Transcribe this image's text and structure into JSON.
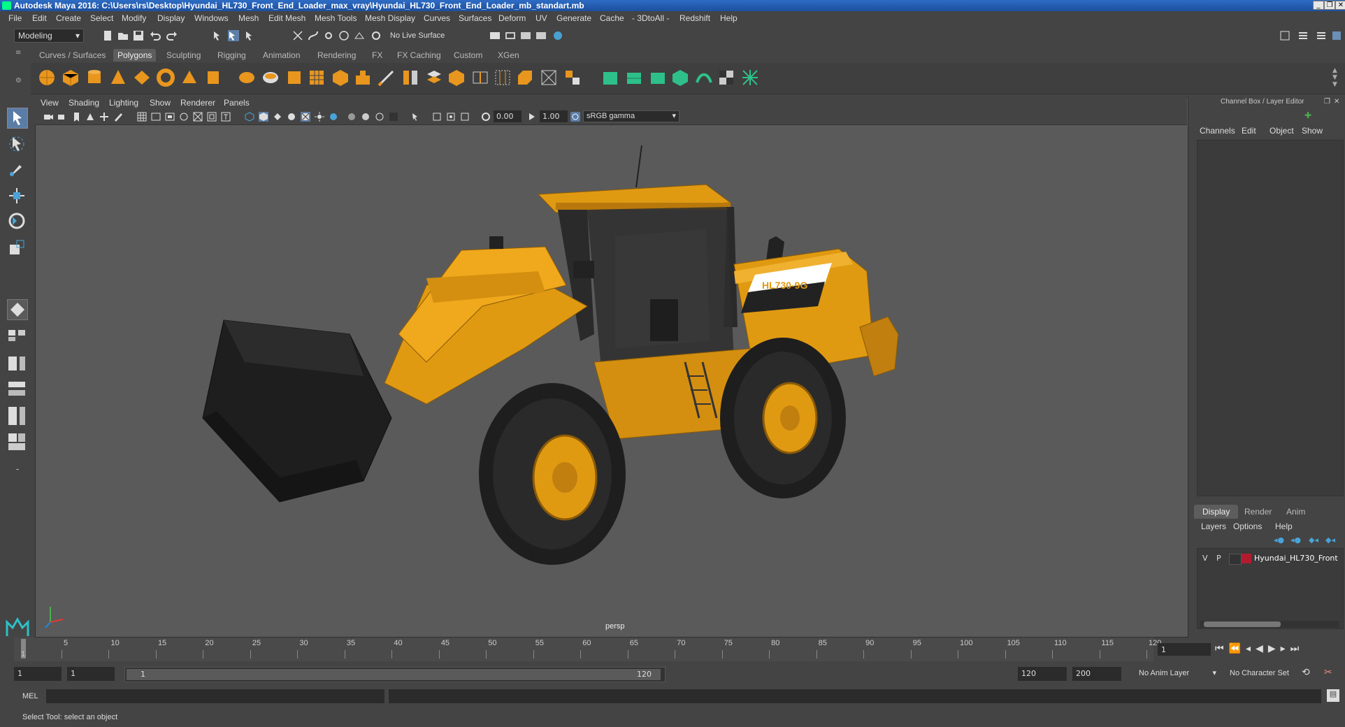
{
  "window": {
    "title": "Autodesk Maya 2016: C:\\Users\\rs\\Desktop\\Hyundai_HL730_Front_End_Loader_max_vray\\Hyundai_HL730_Front_End_Loader_mb_standart.mb"
  },
  "menubar": [
    "File",
    "Edit",
    "Create",
    "Select",
    "Modify",
    "Display",
    "Windows",
    "Mesh",
    "Edit Mesh",
    "Mesh Tools",
    "Mesh Display",
    "Curves",
    "Surfaces",
    "Deform",
    "UV",
    "Generate",
    "Cache",
    "- 3DtoAll -",
    "Redshift",
    "Help"
  ],
  "statusline": {
    "mode": "Modeling",
    "live_surface": "No Live Surface"
  },
  "shelf_tabs": [
    "Curves / Surfaces",
    "Polygons",
    "Sculpting",
    "Rigging",
    "Animation",
    "Rendering",
    "FX",
    "FX Caching",
    "Custom",
    "XGen"
  ],
  "shelf_active": "Polygons",
  "viewport": {
    "menus": [
      "View",
      "Shading",
      "Lighting",
      "Show",
      "Renderer",
      "Panels"
    ],
    "exposure": "0.00",
    "gamma": "1.00",
    "color_space": "sRGB gamma",
    "camera_label": "persp",
    "model_decal": "HL730-9G"
  },
  "channelbox": {
    "header": "Channel Box / Layer Editor",
    "menus": [
      "Channels",
      "Edit",
      "Object",
      "Show"
    ]
  },
  "layereditor": {
    "tabs": [
      "Display",
      "Render",
      "Anim"
    ],
    "active_tab": "Display",
    "menus": [
      "Layers",
      "Options",
      "Help"
    ],
    "layer": {
      "v": "V",
      "p": "P",
      "name": "Hyundai_HL730_Front",
      "color": "#b01c2e"
    }
  },
  "timeslider": {
    "ticks": [
      "5",
      "10",
      "15",
      "20",
      "25",
      "30",
      "35",
      "40",
      "45",
      "50",
      "55",
      "60",
      "65",
      "70",
      "75",
      "80",
      "85",
      "90",
      "95",
      "100",
      "105",
      "110",
      "115",
      "120"
    ],
    "start_label": "1",
    "current_frame": "1"
  },
  "rangebar": {
    "start": "1",
    "playback_start": "1",
    "range_start": "1",
    "range_end": "120",
    "playback_end": "120",
    "end": "200",
    "anim_layer": "No Anim Layer",
    "char_set": "No Character Set"
  },
  "cmdline": {
    "label": "MEL"
  },
  "helpline": {
    "text": "Select Tool: select an object"
  },
  "colors": {
    "accent": "#2e6cc4",
    "loader_yellow": "#e09a12",
    "viewport_bg": "#5a5a5a"
  }
}
